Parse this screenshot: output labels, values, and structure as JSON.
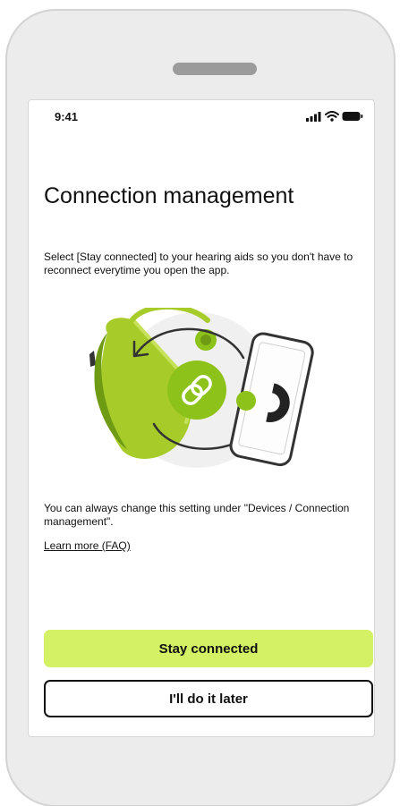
{
  "status_bar": {
    "time": "9:41",
    "icons": [
      "signal-icon",
      "wifi-icon",
      "battery-icon"
    ]
  },
  "content": {
    "title": "Connection management",
    "intro": "Select [Stay connected] to your hearing aids so you don't have to reconnect everytime you open the app.",
    "note": "You can always change this setting under \"Devices / Connection management\".",
    "faq_link": "Learn more (FAQ)"
  },
  "illustration": {
    "icons": [
      "hearing-aid-icon",
      "link-icon",
      "phone-icon",
      "sync-arrows-icon"
    ]
  },
  "actions": {
    "primary_label": "Stay connected",
    "secondary_label": "I'll do it later"
  },
  "colors": {
    "accent": "#d4f165",
    "green": "#8cc21a",
    "dark_green": "#5f8f10",
    "text": "#111111",
    "frame": "#ececec"
  }
}
